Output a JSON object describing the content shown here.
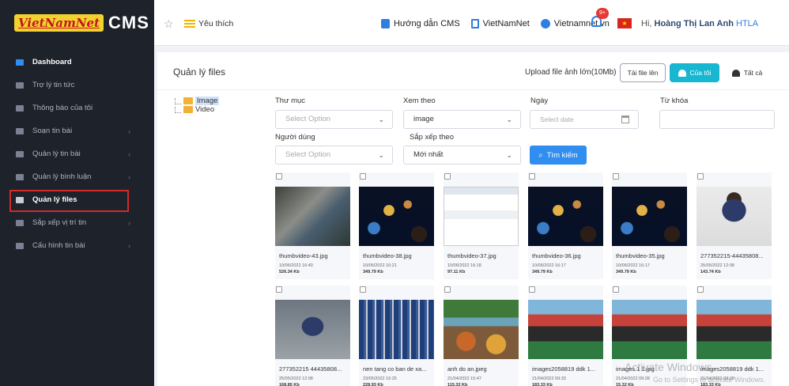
{
  "brand": {
    "logo_text": "VietNamNet",
    "cms_text": "CMS",
    "collapse_icon": "«"
  },
  "topbar": {
    "favorite_label": "Yêu thích",
    "links": [
      "Hướng dẫn CMS",
      "VietNamNet",
      "Vietnamnet.vn"
    ],
    "notification_count": "9+",
    "flag_star": "★",
    "greeting": "Hi,",
    "user_name": "Hoàng Thị Lan Anh",
    "user_suffix": "HTLA"
  },
  "sidebar": {
    "items": [
      {
        "label": "Dashboard",
        "has_sub": false,
        "state": "active"
      },
      {
        "label": "Trợ lý tin tức",
        "has_sub": false,
        "state": ""
      },
      {
        "label": "Thông báo của tôi",
        "has_sub": false,
        "state": ""
      },
      {
        "label": "Soạn tin bài",
        "has_sub": true,
        "state": ""
      },
      {
        "label": "Quản lý tin bài",
        "has_sub": true,
        "state": ""
      },
      {
        "label": "Quản lý bình luận",
        "has_sub": true,
        "state": ""
      },
      {
        "label": "Quản lý files",
        "has_sub": false,
        "state": "highlight"
      },
      {
        "label": "Sắp xếp vị trí tin",
        "has_sub": true,
        "state": ""
      },
      {
        "label": "Cấu hình tin bài",
        "has_sub": true,
        "state": ""
      }
    ],
    "chevron": "›"
  },
  "page": {
    "title": "Quản lý files",
    "upload_hint": "Upload file ảnh lớn(10Mb)",
    "upload_button": "Tải file lên",
    "mine_button": "Của tôi",
    "all_button": "Tất cả"
  },
  "tree": {
    "items": [
      "Image",
      "Video"
    ]
  },
  "filters": {
    "folder_label": "Thư mục",
    "folder_value": "Select Option",
    "view_label": "Xem theo",
    "view_value": "image",
    "date_label": "Ngày",
    "date_placeholder": "Select date",
    "keyword_label": "Từ khóa",
    "keyword_value": "",
    "user_label": "Người dùng",
    "user_value": "Select Option",
    "sort_label": "Sắp xếp theo",
    "sort_value": "Mới nhất",
    "search_button": "Tìm kiếm",
    "caret": "⌄"
  },
  "files": [
    {
      "name": "thumbvideo-43.jpg",
      "date": "10/06/2022 16:40",
      "size": "526.34 Kb",
      "thumb": "th-a"
    },
    {
      "name": "thumbvideo-38.jpg",
      "date": "10/06/2022 16:21",
      "size": "349.79 Kb",
      "thumb": "th-b"
    },
    {
      "name": "thumbvideo-37.jpg",
      "date": "10/06/2022 16:18",
      "size": "97.11 Kb",
      "thumb": "th-c"
    },
    {
      "name": "thumbvideo-36.jpg",
      "date": "10/06/2022 16:17",
      "size": "349.79 Kb",
      "thumb": "th-b"
    },
    {
      "name": "thumbvideo-35.jpg",
      "date": "10/06/2022 16:17",
      "size": "349.79 Kb",
      "thumb": "th-b"
    },
    {
      "name": "277352215-44435808...",
      "date": "25/05/2022 12:08",
      "size": "143.74 Kb",
      "thumb": "th-d"
    },
    {
      "name": "277352215 44435808...",
      "date": "25/05/2022 12:08",
      "size": "168.85 Kb",
      "thumb": "th-e"
    },
    {
      "name": "nen tang co ban de xa...",
      "date": "23/05/2022 16:25",
      "size": "228.93 Kb",
      "thumb": "th-f"
    },
    {
      "name": "anh do an.jpeg",
      "date": "21/04/2022 15:47",
      "size": "115.32 Kb",
      "thumb": "th-g"
    },
    {
      "name": "images2058819 ddk 1...",
      "date": "21/04/2022 09:33",
      "size": "183.33 Kb",
      "thumb": "th-h"
    },
    {
      "name": "images 1 1.jpg",
      "date": "21/04/2022 09:28",
      "size": "15.32 Kb",
      "thumb": "th-h"
    },
    {
      "name": "images2058819 ddk 1...",
      "date": "21/04/2022 09:28",
      "size": "183.33 Kb",
      "thumb": "th-h"
    }
  ],
  "watermark": {
    "title": "Activate Windows",
    "subtitle": "Go to Settings to activate Windows."
  }
}
